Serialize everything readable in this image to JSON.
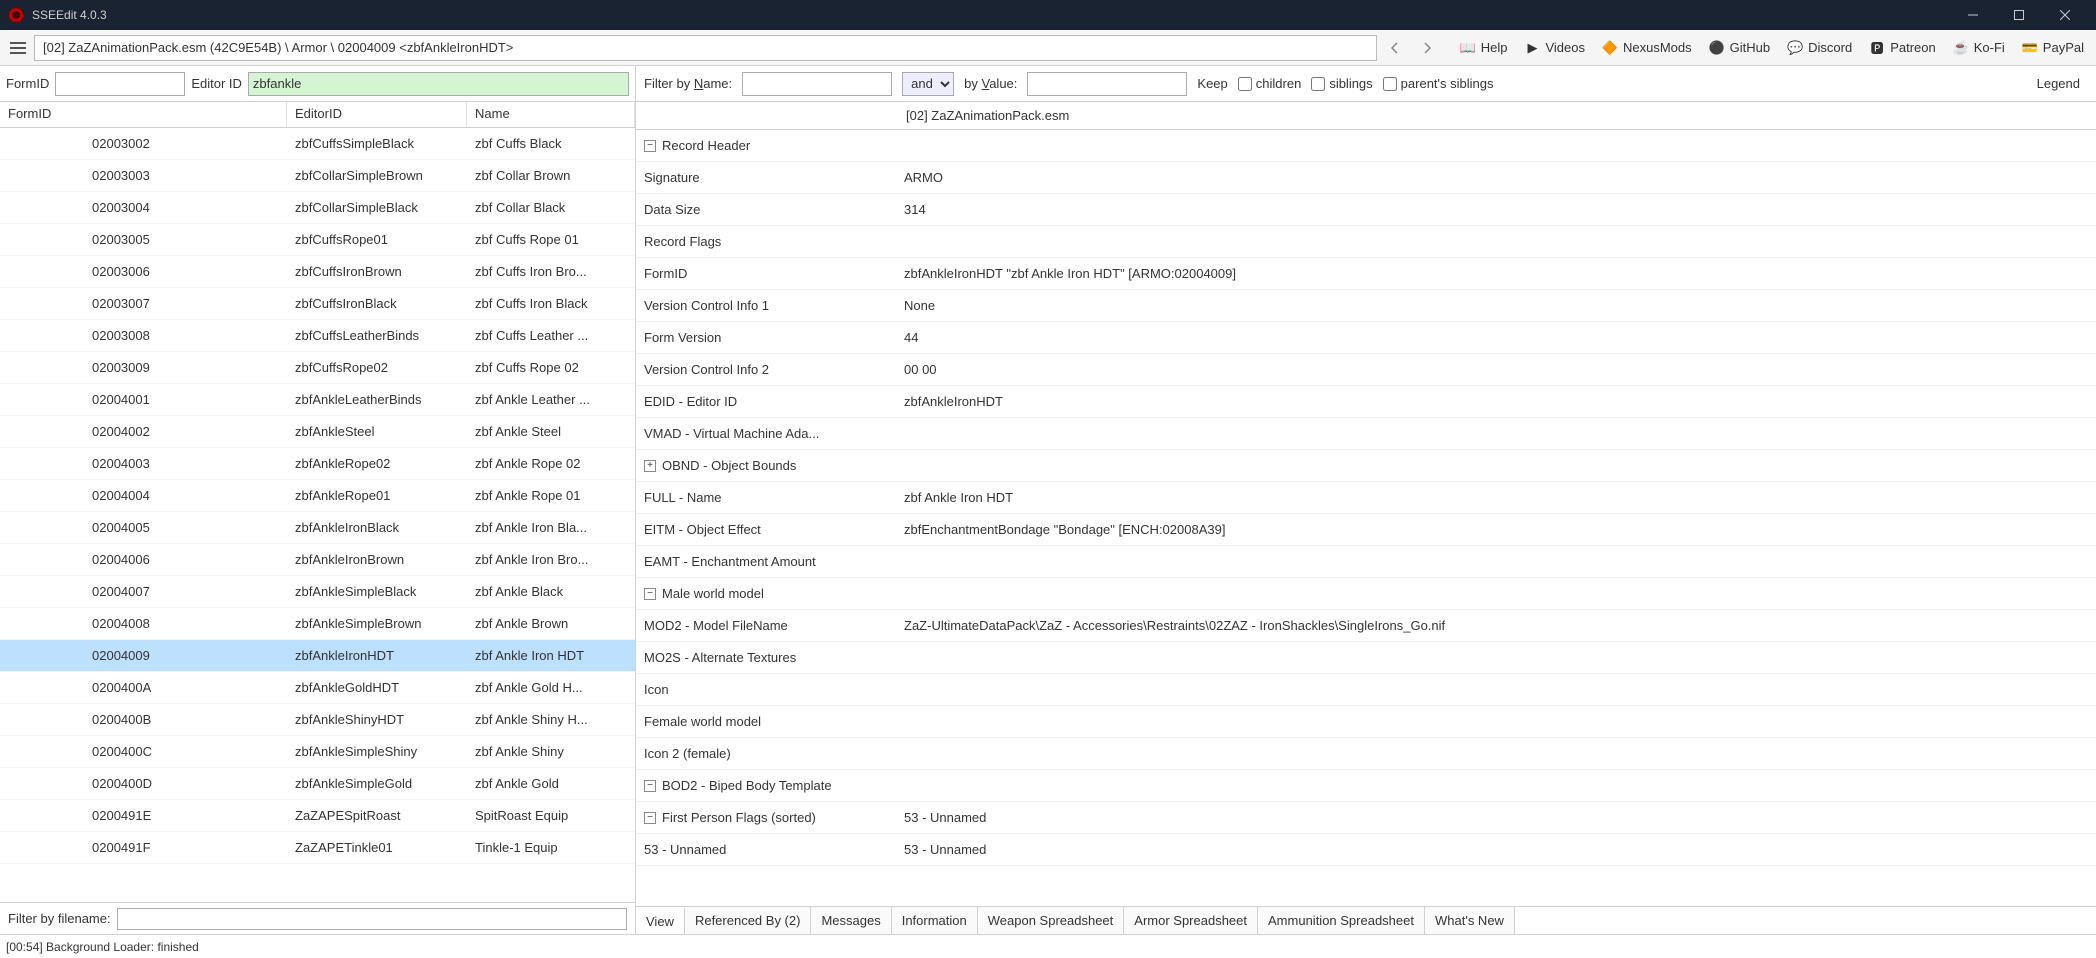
{
  "title": "SSEEdit 4.0.3",
  "breadcrumb": "[02] ZaZAnimationPack.esm (42C9E54B) \\ Armor \\ 02004009 <zbfAnkleIronHDT>",
  "toolbar_links": [
    {
      "icon": "📖",
      "label": "Help"
    },
    {
      "icon": "▶",
      "label": "Videos"
    },
    {
      "icon": "🔶",
      "label": "NexusMods"
    },
    {
      "icon": "⚫",
      "label": "GitHub"
    },
    {
      "icon": "💬",
      "label": "Discord"
    },
    {
      "icon": "🅿",
      "label": "Patreon"
    },
    {
      "icon": "☕",
      "label": "Ko-Fi"
    },
    {
      "icon": "💳",
      "label": "PayPal"
    }
  ],
  "search": {
    "formid_label": "FormID",
    "formid_value": "",
    "editorid_label": "Editor ID",
    "editorid_value": "zbfankle",
    "filter_name_label": "Filter by Name:",
    "filter_name_value": "",
    "andor": "and",
    "by_value_label": "by Value:",
    "by_value_value": "",
    "keep": "Keep",
    "children": "children",
    "siblings": "siblings",
    "parents": "parent's siblings",
    "legend": "Legend"
  },
  "list_headers": {
    "c1": "FormID",
    "c2": "EditorID",
    "c3": "Name"
  },
  "list": [
    {
      "id": "02003002",
      "eid": "zbfCuffsSimpleBlack",
      "name": "zbf Cuffs Black"
    },
    {
      "id": "02003003",
      "eid": "zbfCollarSimpleBrown",
      "name": "zbf Collar Brown"
    },
    {
      "id": "02003004",
      "eid": "zbfCollarSimpleBlack",
      "name": "zbf Collar Black"
    },
    {
      "id": "02003005",
      "eid": "zbfCuffsRope01",
      "name": "zbf Cuffs Rope 01"
    },
    {
      "id": "02003006",
      "eid": "zbfCuffsIronBrown",
      "name": "zbf Cuffs Iron Bro..."
    },
    {
      "id": "02003007",
      "eid": "zbfCuffsIronBlack",
      "name": "zbf Cuffs Iron Black"
    },
    {
      "id": "02003008",
      "eid": "zbfCuffsLeatherBinds",
      "name": "zbf Cuffs Leather ..."
    },
    {
      "id": "02003009",
      "eid": "zbfCuffsRope02",
      "name": "zbf Cuffs Rope 02"
    },
    {
      "id": "02004001",
      "eid": "zbfAnkleLeatherBinds",
      "name": "zbf Ankle Leather ..."
    },
    {
      "id": "02004002",
      "eid": "zbfAnkleSteel",
      "name": "zbf Ankle Steel"
    },
    {
      "id": "02004003",
      "eid": "zbfAnkleRope02",
      "name": "zbf Ankle Rope 02"
    },
    {
      "id": "02004004",
      "eid": "zbfAnkleRope01",
      "name": "zbf Ankle Rope 01"
    },
    {
      "id": "02004005",
      "eid": "zbfAnkleIronBlack",
      "name": "zbf Ankle Iron Bla..."
    },
    {
      "id": "02004006",
      "eid": "zbfAnkleIronBrown",
      "name": "zbf Ankle Iron Bro..."
    },
    {
      "id": "02004007",
      "eid": "zbfAnkleSimpleBlack",
      "name": "zbf Ankle Black"
    },
    {
      "id": "02004008",
      "eid": "zbfAnkleSimpleBrown",
      "name": "zbf Ankle Brown"
    },
    {
      "id": "02004009",
      "eid": "zbfAnkleIronHDT",
      "name": "zbf Ankle Iron HDT",
      "sel": true
    },
    {
      "id": "0200400A",
      "eid": "zbfAnkleGoldHDT",
      "name": "zbf Ankle Gold H..."
    },
    {
      "id": "0200400B",
      "eid": "zbfAnkleShinyHDT",
      "name": "zbf Ankle Shiny H..."
    },
    {
      "id": "0200400C",
      "eid": "zbfAnkleSimpleShiny",
      "name": "zbf Ankle Shiny"
    },
    {
      "id": "0200400D",
      "eid": "zbfAnkleSimpleGold",
      "name": "zbf Ankle Gold"
    },
    {
      "id": "0200491E",
      "eid": "ZaZAPESpitRoast",
      "name": "SpitRoast Equip"
    },
    {
      "id": "0200491F",
      "eid": "ZaZAPETinkle01",
      "name": "Tinkle-1 Equip"
    }
  ],
  "filter_filename_label": "Filter by filename:",
  "detail_header": "[02] ZaZAnimationPack.esm",
  "detail": [
    {
      "ind": 0,
      "toggle": "-",
      "label": "Record Header",
      "value": ""
    },
    {
      "ind": 1,
      "label": "Signature",
      "value": "ARMO"
    },
    {
      "ind": 1,
      "label": "Data Size",
      "value": "314"
    },
    {
      "ind": 1,
      "label": "Record Flags",
      "value": ""
    },
    {
      "ind": 1,
      "label": "FormID",
      "value": "zbfAnkleIronHDT \"zbf Ankle Iron HDT\" [ARMO:02004009]"
    },
    {
      "ind": 1,
      "label": "Version Control Info 1",
      "value": "None"
    },
    {
      "ind": 1,
      "label": "Form Version",
      "value": "44"
    },
    {
      "ind": 1,
      "label": "Version Control Info 2",
      "value": "00 00"
    },
    {
      "ind": 0,
      "label": "EDID - Editor ID",
      "value": "zbfAnkleIronHDT"
    },
    {
      "ind": 0,
      "dim": true,
      "label": "VMAD - Virtual Machine Ada...",
      "value": ""
    },
    {
      "ind": 0,
      "toggle": "+",
      "label": "OBND - Object Bounds",
      "value": ""
    },
    {
      "ind": 0,
      "label": "FULL - Name",
      "value": "zbf Ankle Iron HDT"
    },
    {
      "ind": 0,
      "label": "EITM - Object Effect",
      "value": "zbfEnchantmentBondage \"Bondage\" [ENCH:02008A39]"
    },
    {
      "ind": 0,
      "dim": true,
      "label": "EAMT - Enchantment Amount",
      "value": ""
    },
    {
      "ind": 0,
      "toggle": "-",
      "label": "Male world model",
      "value": ""
    },
    {
      "ind": 1,
      "label": "MOD2 - Model FileName",
      "value": "ZaZ-UltimateDataPack\\ZaZ - Accessories\\Restraints\\02ZAZ - IronShackles\\SingleIrons_Go.nif"
    },
    {
      "ind": 1,
      "dim": true,
      "label": "MO2S - Alternate Textures",
      "value": ""
    },
    {
      "ind": 0,
      "dim": true,
      "label": "Icon",
      "value": ""
    },
    {
      "ind": 0,
      "dim": true,
      "label": "Female world model",
      "value": ""
    },
    {
      "ind": 0,
      "dim": true,
      "label": "Icon 2 (female)",
      "value": ""
    },
    {
      "ind": 0,
      "toggle": "-",
      "label": "BOD2 - Biped Body Template",
      "value": ""
    },
    {
      "ind": 1,
      "toggle": "-",
      "label": "First Person Flags (sorted)",
      "value": "53 - Unnamed"
    },
    {
      "ind": 2,
      "label": "53 - Unnamed",
      "value": "53 - Unnamed"
    }
  ],
  "tabs": [
    "View",
    "Referenced By (2)",
    "Messages",
    "Information",
    "Weapon Spreadsheet",
    "Armor Spreadsheet",
    "Ammunition Spreadsheet",
    "What's New"
  ],
  "status": "[00:54] Background Loader: finished"
}
